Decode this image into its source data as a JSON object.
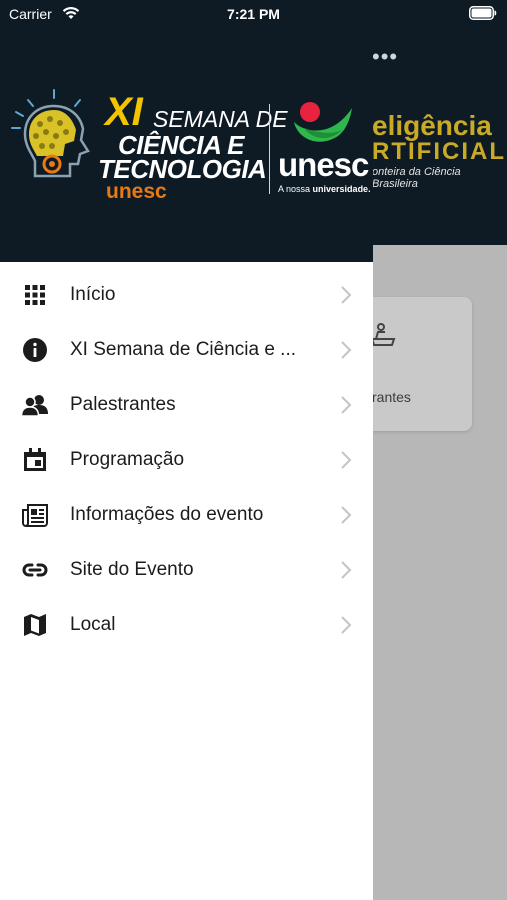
{
  "status_bar": {
    "carrier": "Carrier",
    "time": "7:21 PM"
  },
  "background_app": {
    "banner_line1": "eligência",
    "banner_line2": "RTIFICIAL",
    "banner_subtitle": "onteira da Ciência Brasileira",
    "card_label": "rantes"
  },
  "drawer": {
    "logo": {
      "xi": "XI",
      "semana": "SEMANA DE",
      "ciencia": "CIÊNCIA E",
      "tecnologia": "TECNOLOGIA",
      "unesc_small": "unesc",
      "unesc_large": "unesc",
      "tagline_prefix": "A nossa",
      "tagline_bold": "universidade."
    },
    "menu": [
      {
        "label": "Início",
        "icon": "grid-icon"
      },
      {
        "label": "XI Semana de Ciência e ...",
        "icon": "info-icon"
      },
      {
        "label": "Palestrantes",
        "icon": "people-icon"
      },
      {
        "label": "Programação",
        "icon": "calendar-icon"
      },
      {
        "label": "Informações do evento",
        "icon": "newspaper-icon"
      },
      {
        "label": "Site do Evento",
        "icon": "link-icon"
      },
      {
        "label": "Local",
        "icon": "map-icon"
      }
    ]
  },
  "colors": {
    "header_bg": "#0e1b25",
    "accent_yellow": "#f2c500",
    "accent_orange": "#e57a16",
    "unesc_green": "#2eb84b",
    "unesc_red": "#e8233f"
  }
}
